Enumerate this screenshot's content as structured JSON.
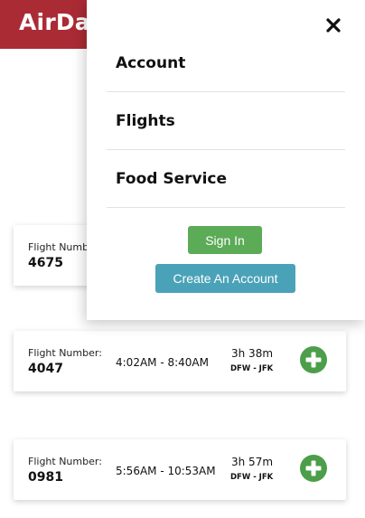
{
  "brand": {
    "name": "AirDa",
    "color": "#ab2b35"
  },
  "menu": {
    "close_icon": "close-icon",
    "items": [
      {
        "label": "Account"
      },
      {
        "label": "Flights"
      },
      {
        "label": "Food Service"
      }
    ],
    "sign_in_label": "Sign In",
    "create_account_label": "Create An Account",
    "sign_in_color": "#5cab57",
    "create_account_color": "#4aa2b8"
  },
  "flights": [
    {
      "label": "Flight Numb",
      "number": "4675"
    },
    {
      "label": "Flight Number:",
      "number": "4047",
      "times": "4:02AM - 8:40AM",
      "duration": "3h 38m",
      "route": "DFW - JFK",
      "add_icon": "add-circle-icon"
    },
    {
      "label": "Flight Number:",
      "number": "0981",
      "times": "5:56AM - 10:53AM",
      "duration": "3h 57m",
      "route": "DFW - JFK",
      "add_icon": "add-circle-icon"
    }
  ],
  "accent_green": "#4c9e4a"
}
